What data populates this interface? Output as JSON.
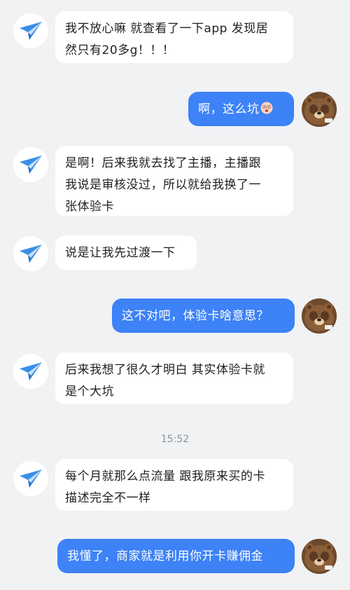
{
  "colors": {
    "background": "#f1f2f4",
    "incoming_bubble": "#ffffff",
    "outgoing_bubble": "#3d82f6",
    "incoming_text": "#1f1f1f",
    "outgoing_text": "#ffffff",
    "timestamp_text": "#8f9399",
    "plane_icon": "#3a8ee6"
  },
  "messages": [
    {
      "side": "incoming",
      "avatar_icon": "paper-plane-icon",
      "text": "我不放心嘛 就查看了一下app 发现居\n然只有20多g！！！"
    },
    {
      "side": "outgoing",
      "avatar_icon": "brown-bear-avatar",
      "text": "啊，这么坑",
      "emoji_icon": "shocked-face-emoji-icon"
    },
    {
      "side": "incoming",
      "avatar_icon": "paper-plane-icon",
      "text": "是啊！后来我就去找了主播，主播跟\n我说是审核没过，所以就给我换了一\n张体验卡"
    },
    {
      "side": "incoming",
      "avatar_icon": "paper-plane-icon",
      "text": "说是让我先过渡一下"
    },
    {
      "side": "outgoing",
      "avatar_icon": "brown-bear-avatar",
      "text": "这不对吧，体验卡啥意思？"
    },
    {
      "side": "incoming",
      "avatar_icon": "paper-plane-icon",
      "text": "后来我想了很久才明白 其实体验卡就\n是个大坑"
    },
    {
      "side": "incoming",
      "avatar_icon": "paper-plane-icon",
      "text": "每个月就那么点流量 跟我原来买的卡\n描述完全不一样"
    },
    {
      "side": "outgoing",
      "avatar_icon": "brown-bear-avatar",
      "text": "我懂了，商家就是利用你开卡赚佣金"
    }
  ],
  "timestamp": "15:52"
}
